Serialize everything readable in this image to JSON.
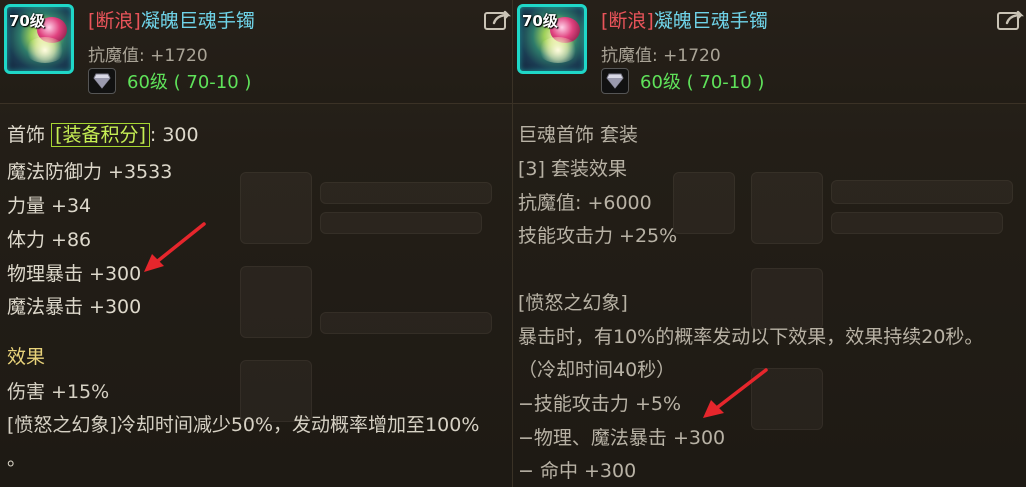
{
  "left": {
    "icon_level": "70级",
    "name_tag": "[断浪]",
    "name": "凝魄巨魂手镯",
    "resist": "抗魔值: +1720",
    "level_req": "60级 ( 70-10 )",
    "category": "首饰",
    "score_label": "[装备积分]",
    "score_value": ": 300",
    "stats": [
      "魔法防御力 +3533",
      "力量 +34",
      "体力 +86",
      "物理暴击 +300",
      "魔法暴击 +300"
    ],
    "effect_title": "效果",
    "effects": [
      "伤害 +15%",
      "[愤怒之幻象]冷却时间减少50%，发动概率增加至100%",
      "。"
    ]
  },
  "right": {
    "icon_level": "70级",
    "name_tag": "[断浪]",
    "name": "凝魄巨魂手镯",
    "resist": "抗魔值: +1720",
    "level_req": "60级 ( 70-10 )",
    "lines": [
      "巨魂首饰 套装",
      "[3] 套装效果",
      "抗魔值: +6000",
      "技能攻击力 +25%",
      "",
      "[愤怒之幻象]",
      "暴击时，有10%的概率发动以下效果，效果持续20秒。",
      "（冷却时间40秒）",
      "−技能攻击力 +5%",
      "−物理、魔法暴击 +300",
      "− 命中 +300"
    ]
  },
  "icons": {
    "share": "share-icon",
    "diamond": "diamond-icon",
    "arrow": "red-arrow-icon"
  },
  "colors": {
    "name": "#6fd3e8",
    "tag": "#e9545a",
    "level": "#5fe25a",
    "score": "#a6d632",
    "arrow": "#e6262c"
  }
}
